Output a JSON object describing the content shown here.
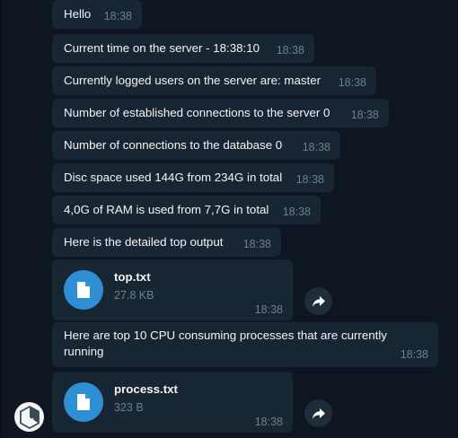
{
  "messages": [
    {
      "text": "Hello",
      "time": "18:38"
    },
    {
      "text": "Current time on the server - 18:38:10",
      "time": "18:38"
    },
    {
      "text": "Currently logged users on the server are: master",
      "time": "18:38"
    },
    {
      "text": "Number of established connections to the server 0",
      "time": "18:38"
    },
    {
      "text": "Number of connections to the database 0",
      "time": "18:38"
    },
    {
      "text": "Disc space used 144G from 234G in total",
      "time": "18:38"
    },
    {
      "text": "4,0G of RAM is used from 7,7G in total",
      "time": "18:38"
    },
    {
      "text": "Here is the detailed top output",
      "time": "18:38"
    },
    {
      "text": "Here are top 10 CPU consuming processes that are currently running",
      "time": "18:38"
    }
  ],
  "files": [
    {
      "name": "top.txt",
      "size": "27.8 KB",
      "time": "18:38",
      "icon": "file-icon"
    },
    {
      "name": "process.txt",
      "size": "323 B",
      "time": "18:38",
      "icon": "file-icon"
    }
  ],
  "colors": {
    "background": "#0e1621",
    "bubble": "#182533",
    "accent": "#2f8fd4",
    "muted": "#6d7f8f"
  }
}
